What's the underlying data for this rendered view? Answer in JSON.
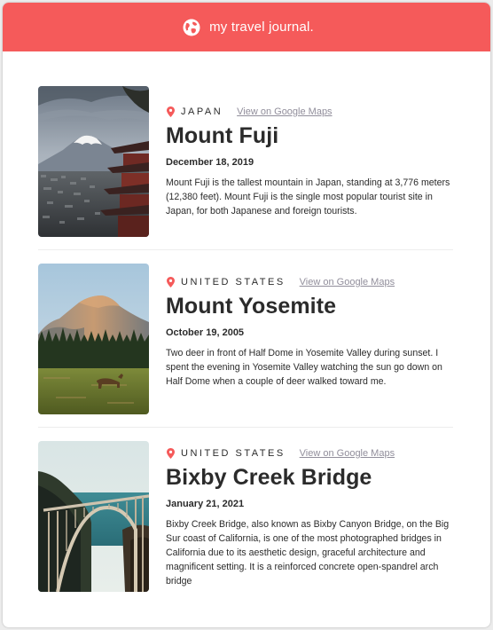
{
  "header": {
    "title": "my travel journal.",
    "logo_icon": "globe-icon",
    "background_color": "#f55a5a"
  },
  "entries": [
    {
      "location": "JAPAN",
      "map_link": "View on Google Maps",
      "title": "Mount Fuji",
      "date": "December 18, 2019",
      "description": "Mount Fuji is the tallest mountain in Japan, standing at 3,776 meters (12,380 feet). Mount Fuji is the single most popular tourist site in Japan, for both Japanese and foreign tourists."
    },
    {
      "location": "UNITED STATES",
      "map_link": "View on Google Maps",
      "title": "Mount Yosemite",
      "date": "October 19, 2005",
      "description": "Two deer in front of Half Dome in Yosemite Valley during sunset. I spent the evening in Yosemite Valley watching the sun go down on Half Dome when a couple of deer walked toward me."
    },
    {
      "location": "UNITED STATES",
      "map_link": "View on Google Maps",
      "title": "Bixby Creek Bridge",
      "date": "January 21, 2021",
      "description": "Bixby Creek Bridge, also known as Bixby Canyon Bridge, on the Big Sur coast of California, is one of the most photographed bridges in California due to its aesthetic design, graceful architecture and magnificent setting. It is a reinforced concrete open-spandrel arch bridge"
    }
  ],
  "accent_color": "#f55a5a",
  "link_color": "#918e9b"
}
